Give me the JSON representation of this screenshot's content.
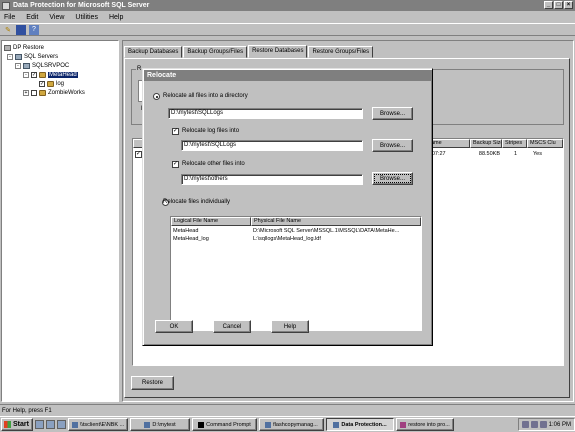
{
  "window": {
    "title": "Data Protection for Microsoft SQL Server",
    "controls": [
      "minimize-icon",
      "maximize-icon",
      "close-icon"
    ]
  },
  "menu": [
    "File",
    "Edit",
    "View",
    "Utilities",
    "Help"
  ],
  "toolbar": [
    "up-folder-icon",
    "book-icon",
    "help-icon"
  ],
  "tree": {
    "items": [
      {
        "label": "DP Restore",
        "icon": "gear-icon"
      },
      {
        "label": "SQL Servers",
        "icon": "server-icon",
        "expander": "-"
      },
      {
        "label": "SQLSRVPOC",
        "icon": "server-icon",
        "expander": "-"
      },
      {
        "label": "MetaHead",
        "icon": "database-icon",
        "expander": "-",
        "checked": true
      },
      {
        "label": "log",
        "icon": "database-icon",
        "checked": true
      },
      {
        "label": "ZombieWorks",
        "icon": "database-icon",
        "expander": "+"
      }
    ]
  },
  "tabs": [
    "Backup Databases",
    "Backup Groups/Files",
    "Restore Databases",
    "Restore Groups/Files"
  ],
  "active_tab": "Restore Databases",
  "main": {
    "groupbox_letter": "R",
    "groupbox_letter2": "R",
    "list_headers": [
      "",
      "ame",
      "Backup Size",
      "Stripes",
      "MSCS Clu"
    ],
    "list_row": {
      "checked": "✓",
      "time": "-07:27",
      "size": "88.50KB",
      "stripes": "1",
      "mscs": "Yes"
    },
    "restore_label": "Restore"
  },
  "statusbar": {
    "text": "For Help, press F1"
  },
  "taskbar": {
    "start_label": "Start",
    "tasks": [
      {
        "label": "\\\\tsclient\\E\\NBK ...",
        "active": false
      },
      {
        "label": "D:\\mytest",
        "active": false
      },
      {
        "label": "Command Prompt",
        "active": false
      },
      {
        "label": "flashcopymanag...",
        "active": false
      },
      {
        "label": "Data Protection...",
        "active": true
      },
      {
        "label": "restore into pro...",
        "active": false
      }
    ],
    "clock": "1:06 PM"
  },
  "dialog": {
    "title": "Relocate",
    "relocate_all_label": "Relocate all files into a directory",
    "relocate_all_value": "D:\\mytest\\SQLLogs",
    "relocate_log_label": "Relocate log files into",
    "relocate_log_value": "D:\\mytest\\SQLLogs",
    "relocate_other_label": "Relocate other files into",
    "relocate_other_value": "D:\\mytest\\others",
    "browse_label": "Browse...",
    "relocate_individually_label": "Relocate files individually",
    "files_headers": [
      "Logical File Name",
      "Physical File Name"
    ],
    "files_rows": [
      {
        "logical": "MetaHead",
        "physical": "D:\\Microsoft SQL Server\\MSSQL.1\\MSSQL\\DATA\\MetaHe..."
      },
      {
        "logical": "MetaHead_log",
        "physical": "L:\\sqllogs\\MetaHead_log.ldf"
      }
    ],
    "ok_label": "OK",
    "cancel_label": "Cancel",
    "help_label": "Help"
  }
}
